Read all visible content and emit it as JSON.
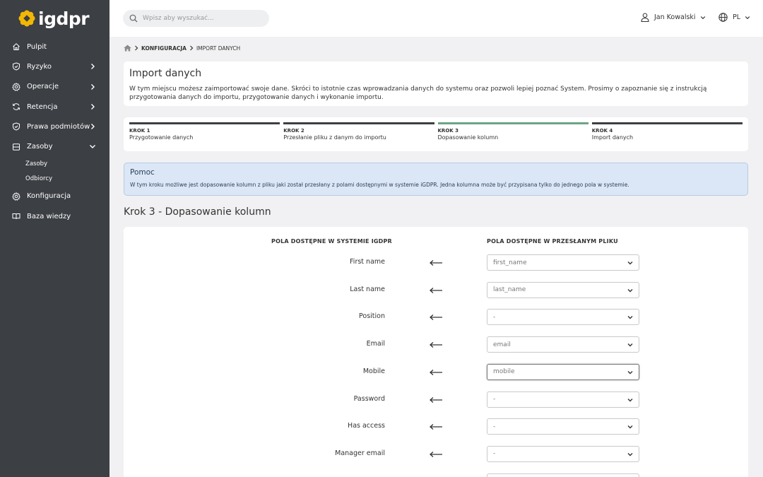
{
  "app": {
    "logo_text": "igdpr"
  },
  "sidebar": {
    "items": [
      {
        "label": "Pulpit",
        "icon": "home-icon",
        "chevron": ""
      },
      {
        "label": "Ryzyko",
        "icon": "shield-icon",
        "chevron": "right"
      },
      {
        "label": "Operacje",
        "icon": "gear-icon",
        "chevron": "right"
      },
      {
        "label": "Retencja",
        "icon": "refresh-icon",
        "chevron": "right"
      },
      {
        "label": "Prawa podmiotów",
        "icon": "shield-icon",
        "chevron": "right"
      },
      {
        "label": "Zasoby",
        "icon": "database-icon",
        "chevron": "down"
      }
    ],
    "subitems": [
      "Zasoby",
      "Odbiorcy"
    ],
    "bottom_items": [
      {
        "label": "Konfiguracja",
        "icon": "gear-icon"
      },
      {
        "label": "Baza wiedzy",
        "icon": "book-icon"
      }
    ]
  },
  "topbar": {
    "search_placeholder": "Wpisz aby wyszukać...",
    "user_name": "Jan Kowalski",
    "language": "PL"
  },
  "breadcrumb": {
    "parent": "KONFIGURACJA",
    "current": "IMPORT DANYCH"
  },
  "intro": {
    "title": "Import danych",
    "text": "W tym miejscu możesz zaimportować swoje dane. Skróci to istotnie czas wprowadzania danych do systemu oraz pozwoli lepiej poznać System. Prosimy o zapoznanie się z instrukcją przygotowania danych do importu, przygotowanie danych i wykonanie importu."
  },
  "steps": [
    {
      "label": "KROK 1",
      "title": "Przygotowanie danych",
      "active": false
    },
    {
      "label": "KROK 2",
      "title": "Przesłanie pliku z danym do importu",
      "active": false
    },
    {
      "label": "KROK 3",
      "title": "Dopasowanie kolumn",
      "active": true
    },
    {
      "label": "KROK 4",
      "title": "Import danych",
      "active": false
    }
  ],
  "help": {
    "title": "Pomoc",
    "text": "W tym kroku możliwe jest dopasowanie kolumn z pliku jaki został przesłany z polami dostępnymi w systemie iGDPR. Jedna kolumna może być przypisana tylko do jednego pola w systemie."
  },
  "section_title": "Krok 3 - Dopasowanie kolumn",
  "mapping": {
    "left_header": "POLA DOSTĘPNE W SYSTEMIE IGDPR",
    "right_header": "POLA DOSTĘPNE W PRZESŁANYM PLIKU",
    "rows": [
      {
        "field": "First name",
        "value": "first_name",
        "focused": false
      },
      {
        "field": "Last name",
        "value": "last_name",
        "focused": false
      },
      {
        "field": "Position",
        "value": "-",
        "focused": false
      },
      {
        "field": "Email",
        "value": "email",
        "focused": false
      },
      {
        "field": "Mobile",
        "value": "mobile",
        "focused": true
      },
      {
        "field": "Password",
        "value": "-",
        "focused": false
      },
      {
        "field": "Has access",
        "value": "-",
        "focused": false
      },
      {
        "field": "Manager email",
        "value": "-",
        "focused": false
      },
      {
        "field": "",
        "value": "",
        "focused": false
      }
    ]
  },
  "colors": {
    "sidebar_bg": "#3c3f44",
    "step_active": "#6aa684",
    "logo_accent": "#f2b705",
    "help_bg": "#dbe7f6"
  }
}
